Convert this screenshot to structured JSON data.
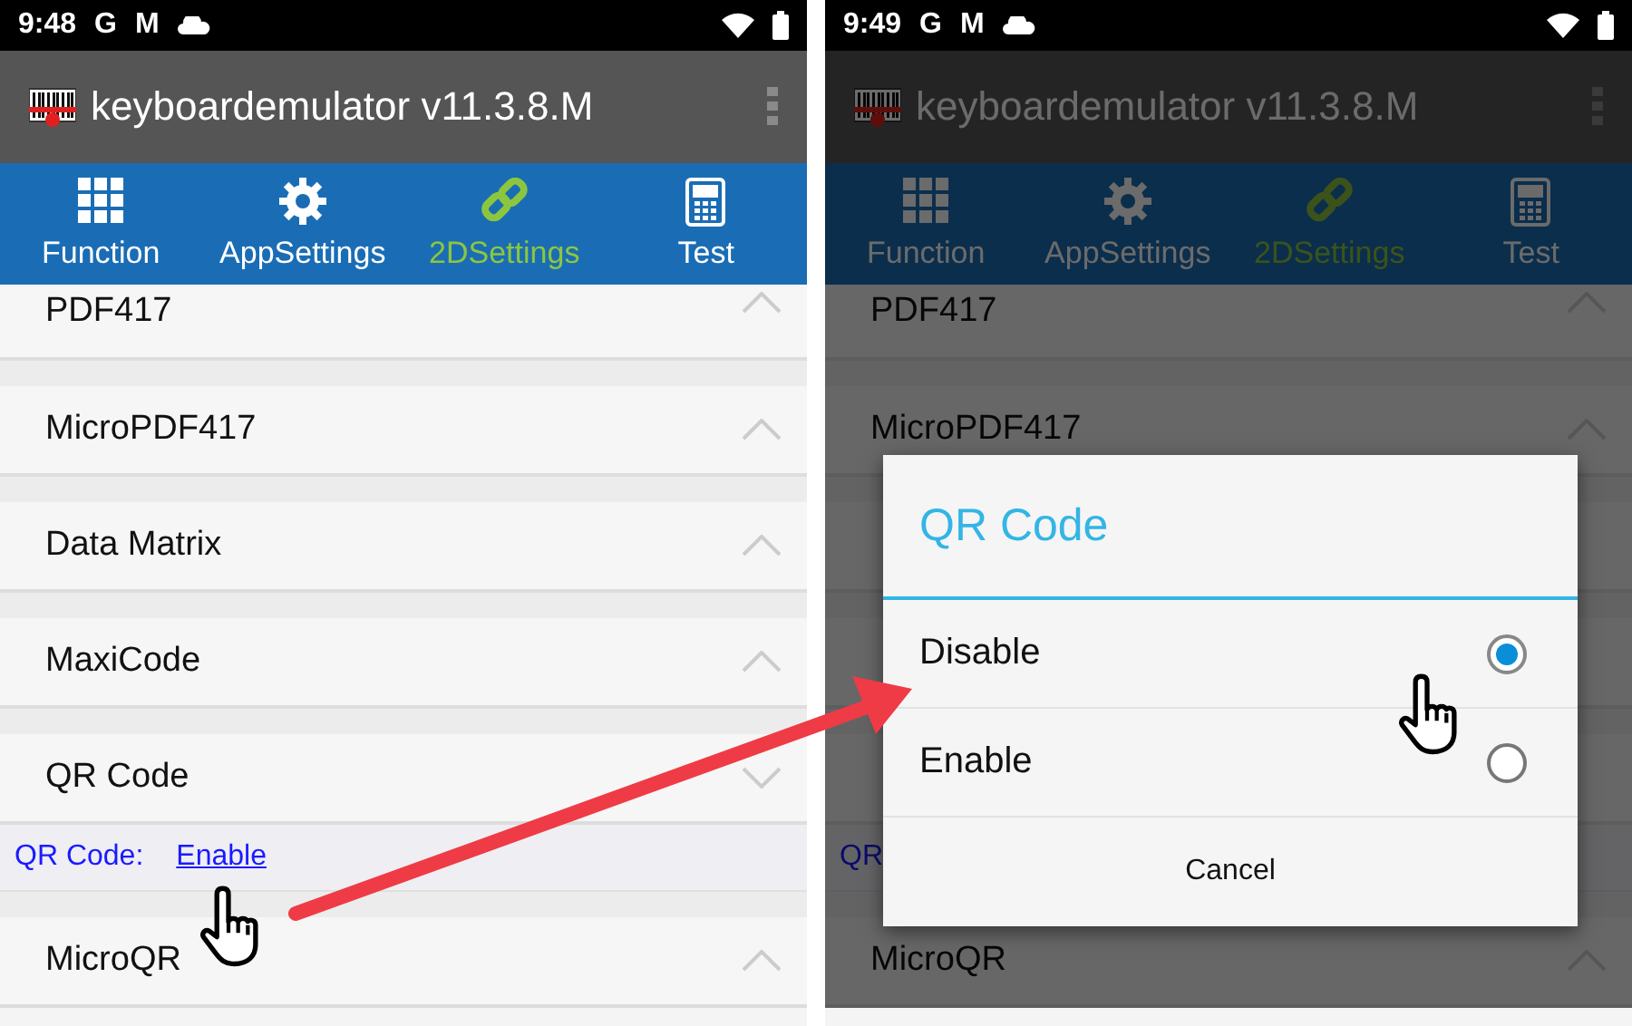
{
  "screens": [
    {
      "dimmed": false,
      "status_bar": {
        "time": "9:48",
        "notifications": [
          "G",
          "M"
        ]
      },
      "app_bar": {
        "title": "keyboardemulator v11.3.8.M"
      },
      "tabs": [
        {
          "label": "Function",
          "selected": false
        },
        {
          "label": "AppSettings",
          "selected": false
        },
        {
          "label": "2DSettings",
          "selected": true
        },
        {
          "label": "Test",
          "selected": false
        }
      ],
      "rows": [
        {
          "kind": "section",
          "title": "PDF417",
          "expanded": false
        },
        {
          "kind": "section",
          "title": "MicroPDF417",
          "expanded": false
        },
        {
          "kind": "section",
          "title": "Data Matrix",
          "expanded": false
        },
        {
          "kind": "section",
          "title": "MaxiCode",
          "expanded": false
        },
        {
          "kind": "section",
          "title": "QR Code",
          "expanded": true
        },
        {
          "kind": "detail",
          "label": "QR Code:",
          "value": "Enable"
        },
        {
          "kind": "section",
          "title": "MicroQR",
          "expanded": false
        }
      ]
    },
    {
      "dimmed": true,
      "status_bar": {
        "time": "9:49",
        "notifications": [
          "G",
          "M"
        ]
      },
      "app_bar": {
        "title": "keyboardemulator v11.3.8.M"
      },
      "tabs": [
        {
          "label": "Function",
          "selected": false
        },
        {
          "label": "AppSettings",
          "selected": false
        },
        {
          "label": "2DSettings",
          "selected": true
        },
        {
          "label": "Test",
          "selected": false
        }
      ],
      "rows": [
        {
          "kind": "section",
          "title": "PDF417",
          "expanded": false
        },
        {
          "kind": "section",
          "title": "MicroPDF417",
          "expanded": false
        },
        {
          "kind": "covered"
        },
        {
          "kind": "covered"
        },
        {
          "kind": "covered"
        },
        {
          "kind": "detail",
          "label": "QR",
          "value": ""
        },
        {
          "kind": "section",
          "title": "MicroQR",
          "expanded": false
        }
      ],
      "dialog": {
        "title": "QR Code",
        "options": [
          {
            "label": "Disable",
            "selected": true
          },
          {
            "label": "Enable",
            "selected": false
          }
        ],
        "button": "Cancel"
      }
    }
  ]
}
